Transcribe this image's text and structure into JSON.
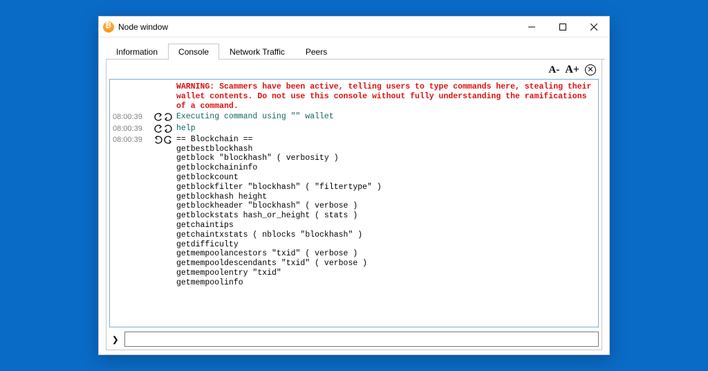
{
  "window": {
    "title": "Node window"
  },
  "tabs": [
    {
      "label": "Information"
    },
    {
      "label": "Console"
    },
    {
      "label": "Network Traffic"
    },
    {
      "label": "Peers"
    }
  ],
  "active_tab": 1,
  "toolbar": {
    "font_smaller": "A-",
    "font_larger": "A+",
    "clear_glyph": "✕"
  },
  "console": {
    "warning": "WARNING: Scammers have been active, telling users to type commands here, stealing their wallet contents. Do not use this console without fully understanding the ramifications of a command.",
    "rows": [
      {
        "ts": "08:00:39",
        "dir": "in",
        "kind": "cmd",
        "text": "Executing command using \"\" wallet"
      },
      {
        "ts": "08:00:39",
        "dir": "in",
        "kind": "cmd",
        "text": "help"
      },
      {
        "ts": "08:00:39",
        "dir": "out",
        "kind": "plain",
        "text": "== Blockchain ==\ngetbestblockhash\ngetblock \"blockhash\" ( verbosity )\ngetblockchaininfo\ngetblockcount\ngetblockfilter \"blockhash\" ( \"filtertype\" )\ngetblockhash height\ngetblockheader \"blockhash\" ( verbose )\ngetblockstats hash_or_height ( stats )\ngetchaintips\ngetchaintxstats ( nblocks \"blockhash\" )\ngetdifficulty\ngetmempoolancestors \"txid\" ( verbose )\ngetmempooldescendants \"txid\" ( verbose )\ngetmempoolentry \"txid\"\ngetmempoolinfo"
      }
    ]
  },
  "input": {
    "prompt": "❯",
    "value": "",
    "placeholder": ""
  }
}
